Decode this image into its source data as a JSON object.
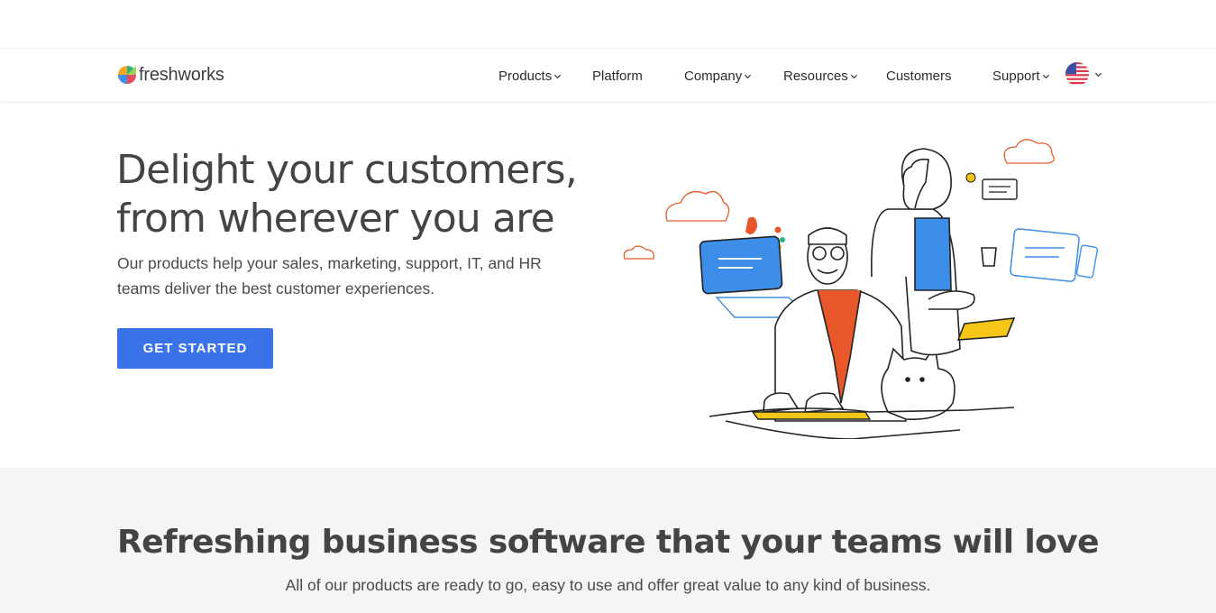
{
  "brand": {
    "name": "freshworks"
  },
  "nav": {
    "items": [
      {
        "label": "Products",
        "has_dropdown": true
      },
      {
        "label": "Platform",
        "has_dropdown": false
      },
      {
        "label": "Company",
        "has_dropdown": true
      },
      {
        "label": "Resources",
        "has_dropdown": true
      },
      {
        "label": "Customers",
        "has_dropdown": false
      },
      {
        "label": "Support",
        "has_dropdown": true
      }
    ],
    "language_icon": "us-flag-icon"
  },
  "hero": {
    "title_line1": "Delight your customers,",
    "title_line2": "from wherever you are",
    "subtitle": "Our products help your sales, marketing, support, IT, and HR teams deliver the best customer experiences.",
    "cta_label": "GET STARTED"
  },
  "section2": {
    "title": "Refreshing business software that your teams will love",
    "subtitle": "All of our products are ready to go, easy to use and offer great value to any kind of business."
  },
  "colors": {
    "accent": "#3a72e8",
    "heading": "#444444",
    "section_bg": "#f5f5f5",
    "illustration_orange": "#e8572a",
    "illustration_blue": "#3d8ee8",
    "illustration_yellow": "#f5c518"
  }
}
